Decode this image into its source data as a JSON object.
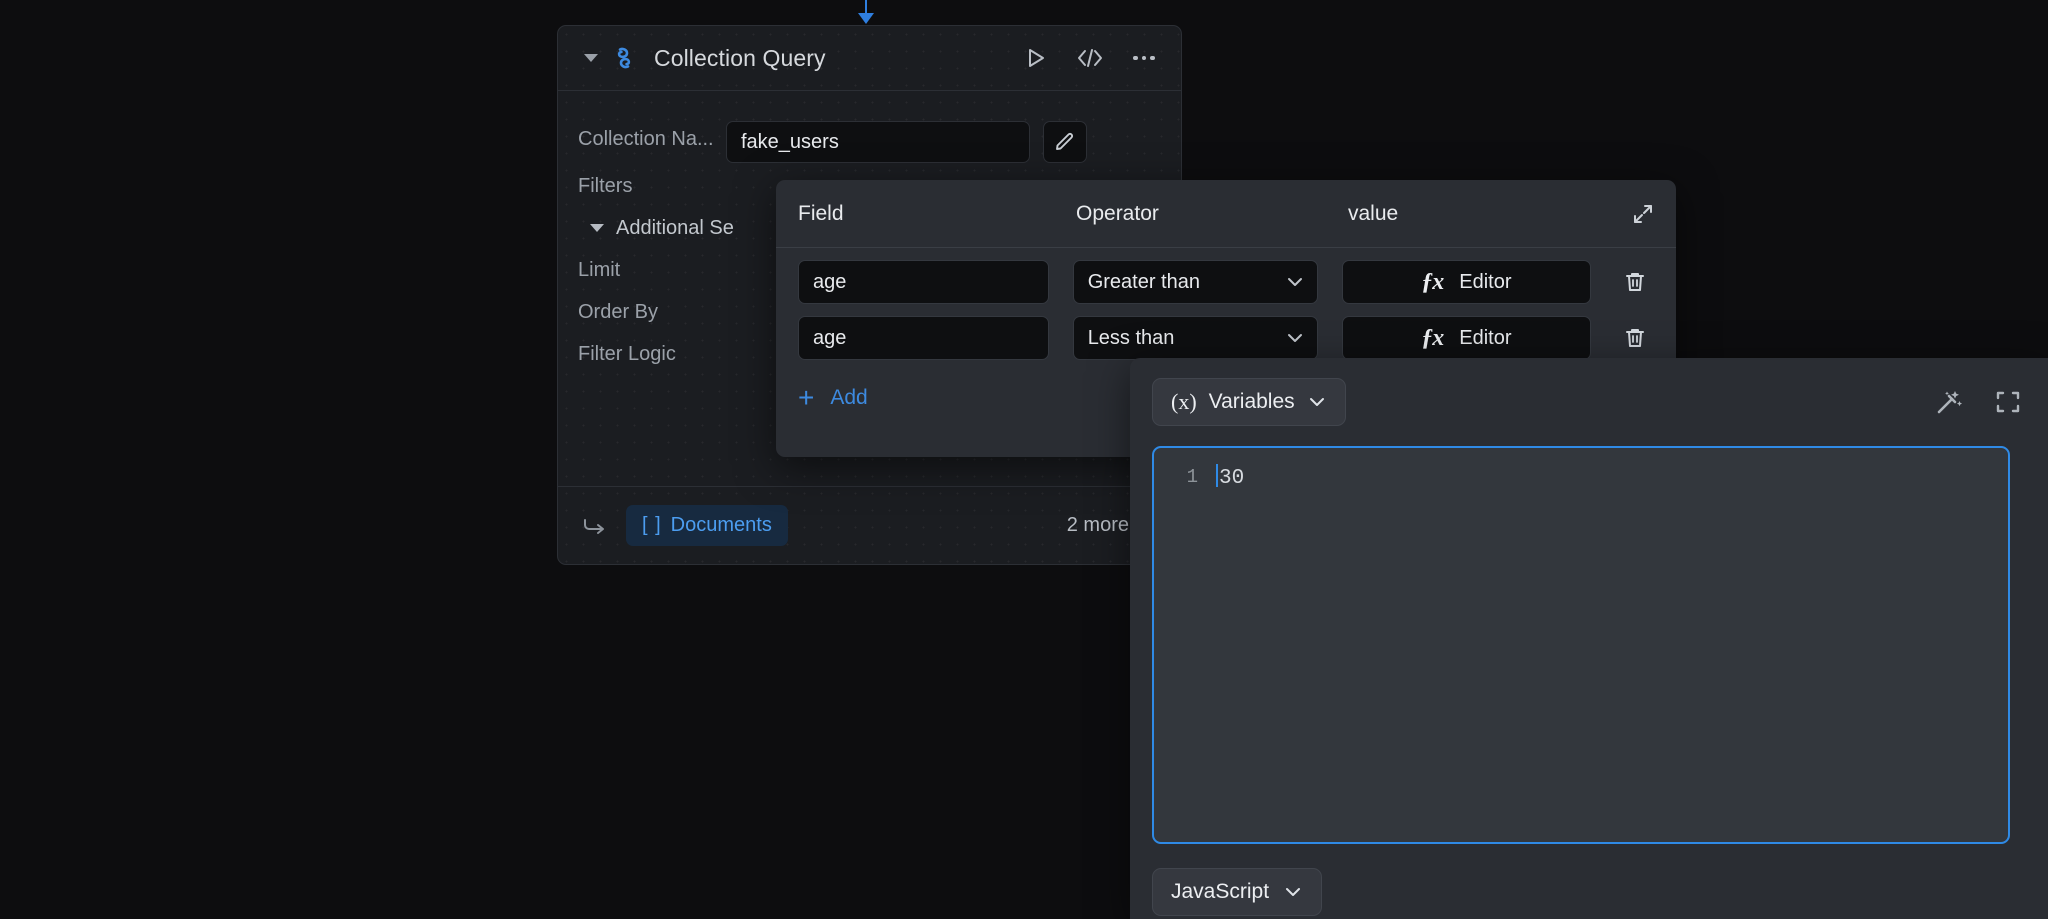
{
  "node": {
    "title": "Collection Query",
    "icon": "convex-logo-icon",
    "collapse_icon": "caret-down-icon",
    "actions": {
      "run_label": "run-icon",
      "code_label": "code-icon",
      "more_label": "more-options-icon"
    },
    "fields": [
      {
        "label": "Collection Na...",
        "name": "collection-name"
      },
      {
        "label": "Filters",
        "name": "filters"
      },
      {
        "label": "Additional Se",
        "name": "additional-settings"
      },
      {
        "label": "Limit",
        "name": "limit"
      },
      {
        "label": "Order By",
        "name": "order-by"
      },
      {
        "label": "Filter Logic",
        "name": "filter-logic"
      }
    ],
    "collection_value": "fake_users",
    "edit_icon": "pencil-icon",
    "footer": {
      "return_icon": "return-arrow-icon",
      "documents_bracket": "[ ]",
      "documents_label": "Documents",
      "more_label": "2 more"
    }
  },
  "filters_popover": {
    "columns": {
      "field": "Field",
      "operator": "Operator",
      "value": "value"
    },
    "expand_icon": "expand-diagonal-icon",
    "rows": [
      {
        "field": "age",
        "operator": "Greater than",
        "value_label": "Editor",
        "fx": "ƒx",
        "delete_icon": "trash-icon"
      },
      {
        "field": "age",
        "operator": "Less than",
        "value_label": "Editor",
        "fx": "ƒx",
        "delete_icon": "trash-icon"
      }
    ],
    "add_label": "Add",
    "add_icon": "plus-icon"
  },
  "code_panel": {
    "variables_label": "Variables",
    "variables_prefix": "(x)",
    "variables_caret": "chevron-down-icon",
    "magic_icon": "magic-wand-icon",
    "fullscreen_icon": "fullscreen-icon",
    "editor": {
      "line_number": "1",
      "content": "30"
    },
    "language_label": "JavaScript",
    "language_caret": "chevron-down-icon"
  },
  "colors": {
    "accent": "#2f8ae6",
    "panel": "#2a2d33",
    "node_bg": "#1b1d21",
    "canvas": "#0d0d0f",
    "link_blue": "#4c9df0"
  }
}
